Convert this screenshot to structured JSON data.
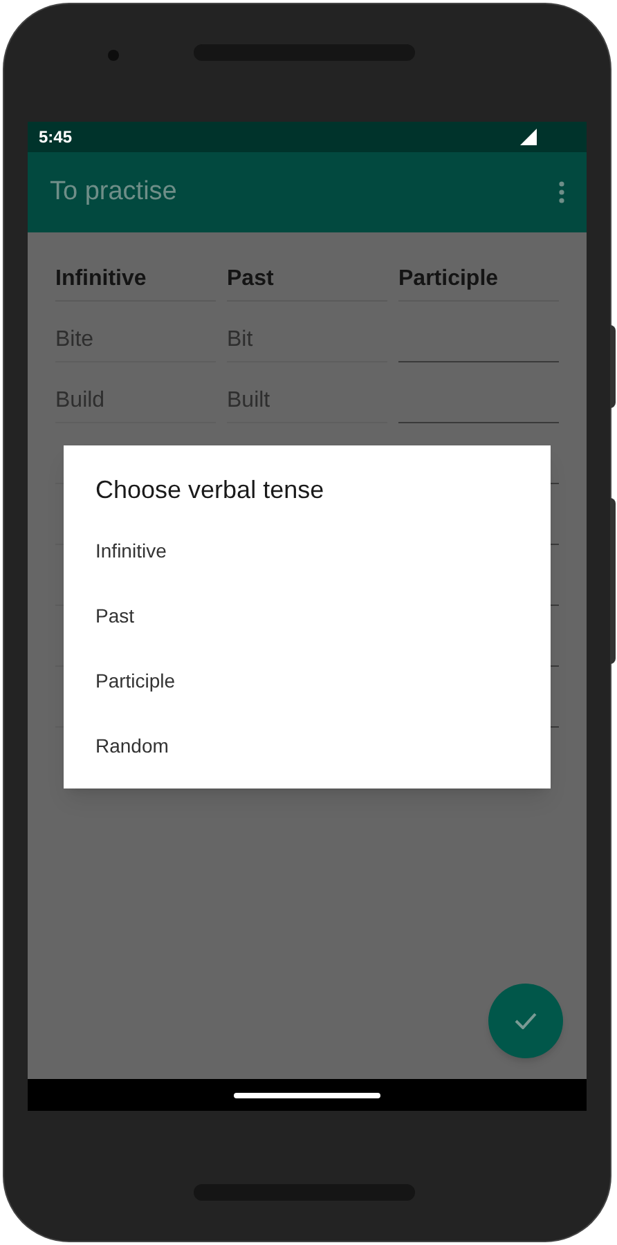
{
  "status_bar": {
    "time": "5:45"
  },
  "app_bar": {
    "title": "To practise"
  },
  "table": {
    "columns": [
      "Infinitive",
      "Past",
      "Participle"
    ],
    "rows": [
      {
        "kind": "filled",
        "values": [
          "Bite",
          "Bit"
        ]
      },
      {
        "kind": "filled",
        "values": [
          "Build",
          "Built"
        ]
      },
      {
        "kind": "blank"
      },
      {
        "kind": "blank"
      },
      {
        "kind": "blank"
      },
      {
        "kind": "blank"
      },
      {
        "kind": "blank"
      }
    ]
  },
  "dialog": {
    "title": "Choose verbal tense",
    "options": [
      "Infinitive",
      "Past",
      "Participle",
      "Random"
    ]
  }
}
